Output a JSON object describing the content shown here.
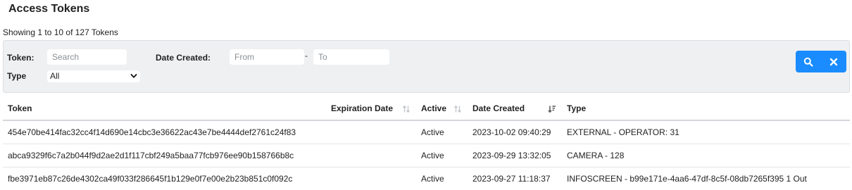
{
  "page": {
    "title": "Access Tokens",
    "showing": "Showing 1 to 10 of 127 Tokens"
  },
  "filters": {
    "token_label": "Token:",
    "token_placeholder": "Search",
    "date_label": "Date Created:",
    "from_placeholder": "From",
    "dash": "-",
    "to_placeholder": "To",
    "type_label": "Type",
    "type_value": "All"
  },
  "buttons": {
    "search_icon": "search-icon",
    "clear_icon": "close-icon",
    "accent": "#1a8cff"
  },
  "table": {
    "headers": [
      "Token",
      "Expiration Date",
      "Active",
      "Date Created",
      "Type"
    ],
    "sort": {
      "expiration": "unsorted",
      "active": "unsorted",
      "date_created": "descending"
    },
    "rows": [
      {
        "token": "454e70be414fac32cc4f14d690e14cbc3e36622ac43e7be4444def2761c24f83",
        "expiration": "",
        "active": "Active",
        "created": "2023-10-02 09:40:29",
        "type": "EXTERNAL - OPERATOR: 31"
      },
      {
        "token": "abca9329f6c7a2b044f9d2ae2d1f117cbf249a5baa77fcb976ee90b158766b8c",
        "expiration": "",
        "active": "Active",
        "created": "2023-09-29 13:32:05",
        "type": "CAMERA - 128"
      },
      {
        "token": "fbe3971eb87c26de4302ca49f033f286645f1b129e0f7e00e2b23b851c0f092c",
        "expiration": "",
        "active": "Active",
        "created": "2023-09-27 11:18:37",
        "type": "INFOSCREEN - b99e171e-4aa6-47df-8c5f-08db7265f395 1 Out"
      }
    ]
  }
}
